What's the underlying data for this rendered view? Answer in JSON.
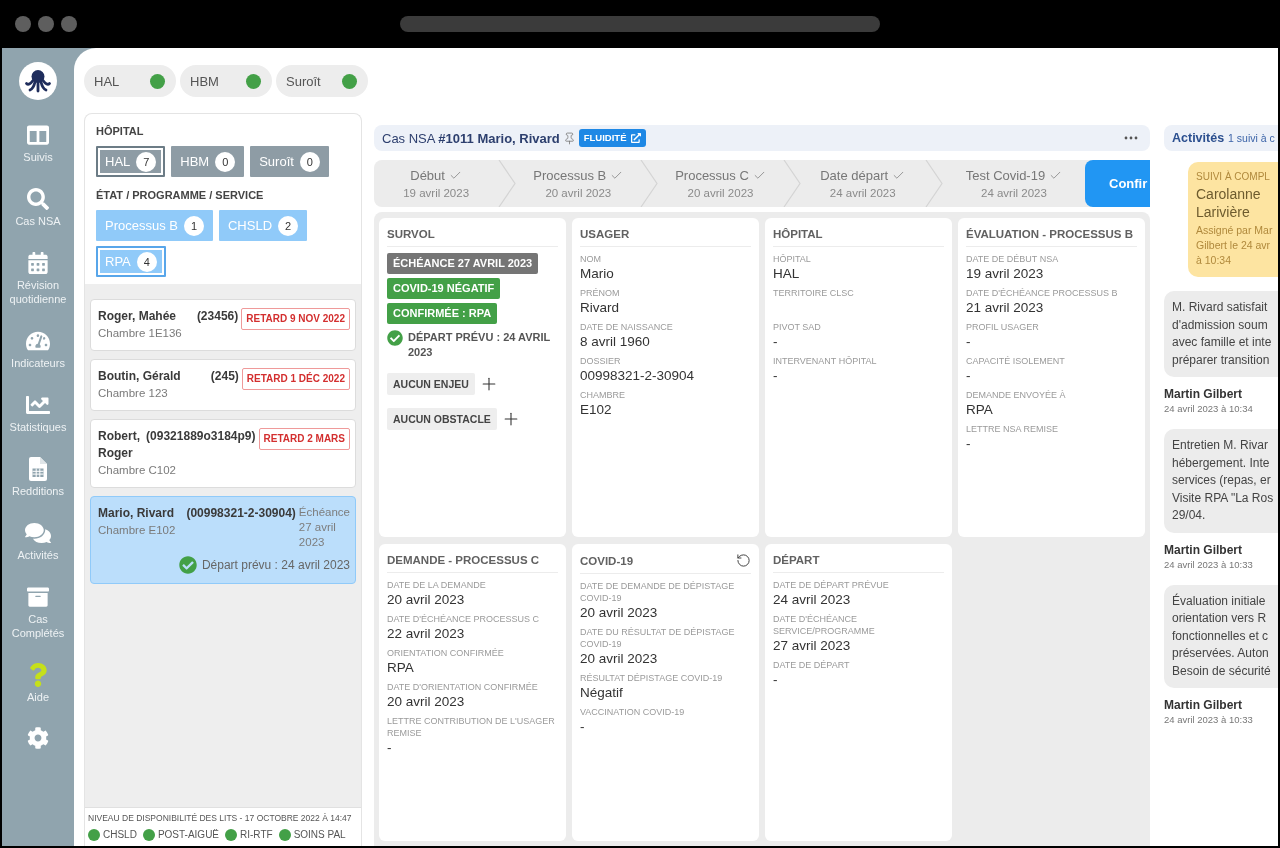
{
  "nav": {
    "items": [
      {
        "label": "Suivis"
      },
      {
        "label": "Cas NSA"
      },
      {
        "label": "Révision quotidienne"
      },
      {
        "label": "Indicateurs"
      },
      {
        "label": "Statistiques"
      },
      {
        "label": "Redditions"
      },
      {
        "label": "Activités"
      },
      {
        "label": "Cas Complétés"
      },
      {
        "label": "Aide"
      }
    ]
  },
  "hospital_status": [
    {
      "label": "HAL",
      "color": "#43a047"
    },
    {
      "label": "HBM",
      "color": "#43a047"
    },
    {
      "label": "Suroît",
      "color": "#43a047"
    }
  ],
  "filters": [
    {
      "title": "HÔPITAL",
      "kind": "hospital",
      "options": [
        {
          "label": "HAL",
          "count": "7",
          "selected": true
        },
        {
          "label": "HBM",
          "count": "0",
          "selected": false
        },
        {
          "label": "Suroît",
          "count": "0",
          "selected": false
        }
      ]
    },
    {
      "title": "ÉTAT / PROGRAMME / SERVICE",
      "kind": "program",
      "options": [
        {
          "label": "Processus B",
          "count": "1",
          "selected": false
        },
        {
          "label": "CHSLD",
          "count": "2",
          "selected": false
        },
        {
          "label": "RPA",
          "count": "4",
          "selected": true
        }
      ]
    }
  ],
  "cases": [
    {
      "name": "Roger, Mahée",
      "id": "(23456)",
      "room": "Chambre 1E136",
      "badge": "RETARD 9 NOV 2022",
      "selected": false
    },
    {
      "name": "Boutin, Gérald",
      "id": "(245)",
      "room": "Chambre 123",
      "badge": "RETARD 1 DÉC 2022",
      "selected": false
    },
    {
      "name": "Robert, Roger",
      "id": "(09321889o3184p9)",
      "room": "Chambre C102",
      "badge": "RETARD 2 MARS",
      "selected": false
    },
    {
      "name": "Mario, Rivard",
      "id": "(00998321-2-30904)",
      "room": "Chambre E102",
      "due": "Échéance 27 avril 2023",
      "departure": "Départ prévu : 24 avril 2023",
      "selected": true
    }
  ],
  "bed_availability": {
    "title": "NIVEAU DE DISPONIBILITÉ DES LITS - 17 OCTOBRE 2022 À 14:47",
    "items": [
      {
        "label": "CHSLD",
        "color": "#43a047"
      },
      {
        "label": "POST-AIGUË",
        "color": "#43a047"
      },
      {
        "label": "RI-RTF",
        "color": "#43a047"
      },
      {
        "label": "SOINS PAL",
        "color": "#43a047"
      }
    ]
  },
  "case_header": {
    "title": "Cas NSA **#1011 Mario, Rivard**",
    "badge": "FLUIDITÉ"
  },
  "steps": [
    {
      "label": "Début",
      "date": "19 avril 2023",
      "completed": true
    },
    {
      "label": "Processus B",
      "date": "20 avril 2023",
      "completed": true
    },
    {
      "label": "Processus C",
      "date": "20 avril 2023",
      "completed": true
    },
    {
      "label": "Date départ",
      "date": "24 avril 2023",
      "completed": true
    },
    {
      "label": "Test Covid-19",
      "date": "24 avril 2023",
      "completed": true
    }
  ],
  "confirm_button": "Confir",
  "cards": [
    {
      "kind": "overview",
      "title": "SURVOL",
      "resettable": false,
      "tags": [
        {
          "text": "ÉCHÉANCE 27 AVRIL 2023",
          "color": "#757575"
        },
        {
          "text": "COVID-19 NÉGATIF",
          "color": "#43a047"
        },
        {
          "text": "CONFIRMÉE : RPA",
          "color": "#43a047"
        }
      ],
      "departure": "DÉPART PRÉVU : 24 AVRIL 2023",
      "actions": [
        "AUCUN ENJEU",
        "AUCUN OBSTACLE"
      ]
    },
    {
      "kind": "fields",
      "title": "USAGER",
      "resettable": false,
      "fields": [
        {
          "label": "NOM",
          "value": "Mario"
        },
        {
          "label": "PRÉNOM",
          "value": "Rivard"
        },
        {
          "label": "DATE DE NAISSANCE",
          "value": "8 avril 1960"
        },
        {
          "label": "DOSSIER",
          "value": "00998321-2-30904"
        },
        {
          "label": "CHAMBRE",
          "value": "E102"
        }
      ]
    },
    {
      "kind": "fields",
      "title": "HÔPITAL",
      "resettable": false,
      "fields": [
        {
          "label": "HÔPITAL",
          "value": "HAL"
        },
        {
          "label": "TERRITOIRE CLSC"
        },
        {
          "label": "PIVOT SAD",
          "value": "-"
        },
        {
          "label": "INTERVENANT HÔPITAL",
          "value": "-"
        }
      ]
    },
    {
      "kind": "fields",
      "title": "ÉVALUATION - PROCESSUS B",
      "resettable": false,
      "fields": [
        {
          "label": "DATE DE DÉBUT NSA",
          "value": "19 avril 2023"
        },
        {
          "label": "DATE D'ÉCHÉANCE PROCESSUS B",
          "value": "21 avril 2023"
        },
        {
          "label": "PROFIL USAGER",
          "value": "-"
        },
        {
          "label": "CAPACITÉ ISOLEMENT",
          "value": "-"
        },
        {
          "label": "DEMANDE ENVOYÉE À",
          "value": "RPA"
        },
        {
          "label": "LETTRE NSA REMISE",
          "value": "-"
        }
      ]
    },
    {
      "kind": "fields",
      "title": "DEMANDE - PROCESSUS C",
      "resettable": false,
      "fields": [
        {
          "label": "DATE DE LA DEMANDE",
          "value": "20 avril 2023"
        },
        {
          "label": "DATE D'ÉCHÉANCE PROCESSUS C",
          "value": "22 avril 2023"
        },
        {
          "label": "ORIENTATION CONFIRMÉE",
          "value": "RPA"
        },
        {
          "label": "DATE D'ORIENTATION CONFIRMÉE",
          "value": "20 avril 2023"
        },
        {
          "label": "LETTRE CONTRIBUTION DE L'USAGER REMISE",
          "value": "-"
        }
      ]
    },
    {
      "kind": "fields",
      "title": "COVID-19",
      "resettable": true,
      "fields": [
        {
          "label": "DATE DE DEMANDE DE DÉPISTAGE COVID-19",
          "value": "20 avril 2023"
        },
        {
          "label": "DATE DU RÉSULTAT DE DÉPISTAGE COVID-19",
          "value": "20 avril 2023"
        },
        {
          "label": "RÉSULTAT DÉPISTAGE COVID-19",
          "value": "Négatif"
        },
        {
          "label": "VACCINATION COVID-19",
          "value": "-"
        }
      ]
    },
    {
      "kind": "fields",
      "title": "DÉPART",
      "resettable": false,
      "fields": [
        {
          "label": "DATE DE DÉPART PRÉVUE",
          "value": "24 avril 2023"
        },
        {
          "label": "DATE D'ÉCHÉANCE SERVICE/PROGRAMME",
          "value": "27 avril 2023"
        },
        {
          "label": "DATE DE DÉPART",
          "value": "-"
        }
      ]
    }
  ],
  "activities": {
    "title": "Activités",
    "subtitle": "1 suivi à c",
    "followup": {
      "status": "SUIVI À COMPL",
      "assignee": "Carolanne Larivière",
      "note_lines": [
        "Assigné par Mar",
        "Gilbert le 24 avr",
        "à 10:34"
      ]
    },
    "messages": [
      {
        "lines": [
          "M. Rivard satisfait",
          "d'admission soum",
          "avec famille et inte",
          "préparer transition"
        ],
        "author": "Martin Gilbert",
        "time": "24 avril 2023 à 10:34"
      },
      {
        "lines": [
          "Entretien M. Rivar",
          "hébergement. Inte",
          "services (repas, er",
          "Visite RPA \"La Ros",
          "29/04."
        ],
        "author": "Martin Gilbert",
        "time": "24 avril 2023 à 10:33"
      },
      {
        "lines": [
          "Évaluation initiale",
          "orientation vers R",
          "fonctionnelles et c",
          "préservées. Auton",
          "Besoin de sécurité"
        ],
        "author": "Martin Gilbert",
        "time": "24 avril 2023 à 10:33"
      }
    ]
  }
}
